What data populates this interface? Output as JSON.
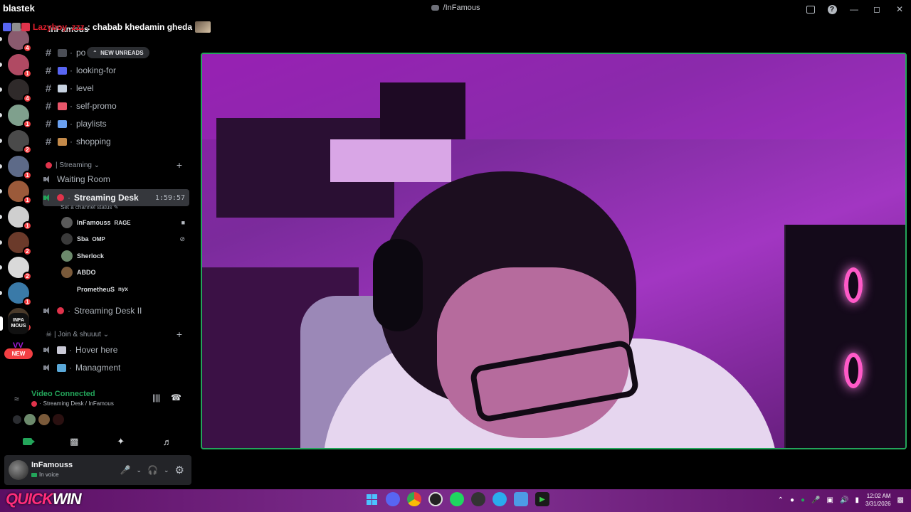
{
  "window": {
    "title": "/InFamous"
  },
  "overlay": {
    "streamer": "blastek",
    "chat_user": "Lazyboy_zzz",
    "chat_message": ": chabab khedamin gheda"
  },
  "rail": {
    "servers": [
      {
        "badge": "4",
        "color": "#8a5a6e"
      },
      {
        "badge": "1",
        "color": "#b04a63"
      },
      {
        "badge": "4",
        "color": "#2f2a2a"
      },
      {
        "badge": "1",
        "color": "#7fa08d"
      },
      {
        "badge": "2",
        "color": "#4a4a4a"
      },
      {
        "badge": "1",
        "color": "#5d6a88"
      },
      {
        "badge": "1",
        "color": "#9b5a3a"
      },
      {
        "badge": "1",
        "color": "#cfcfcf"
      },
      {
        "badge": "2",
        "color": "#6b3a2a"
      },
      {
        "badge": "2",
        "color": "#d9d9d9"
      },
      {
        "badge": "1",
        "color": "#3a7aa8"
      },
      {
        "badge": "2",
        "color": "#4a3a2a"
      }
    ],
    "infamous_label": "INFA MOUS",
    "new_label": "NEW"
  },
  "channels": {
    "server_name": "InFamous",
    "new_unreads": "NEW UNREADS",
    "partial_first": "po",
    "text_channels": [
      {
        "name": "looking-for",
        "emoji_color": "#5865f2"
      },
      {
        "name": "level",
        "emoji_color": "#c7d2e0"
      },
      {
        "name": "self-promo",
        "emoji_color": "#e8566a"
      },
      {
        "name": "playlists",
        "emoji_color": "#6aa0f0"
      },
      {
        "name": "shopping",
        "emoji_color": "#c48a4a"
      }
    ],
    "category_streaming": "| Streaming",
    "waiting_room": "Waiting Room",
    "active_channel": {
      "name": "Streaming Desk",
      "timer": "1:59:57",
      "status": "Set a channel status"
    },
    "members": [
      {
        "name": "InFamouss",
        "tag": "RAGE",
        "color": "#5a5a5a"
      },
      {
        "name": "Sba",
        "tag": "OMP",
        "color": "#3a3a3a"
      },
      {
        "name": "Sherlock",
        "tag": "",
        "color": "#6c8a6c"
      },
      {
        "name": "ABDO",
        "tag": "",
        "color": "#7a5a3a"
      },
      {
        "name": "PrometheuS",
        "tag": "nyx",
        "color": "#000000"
      }
    ],
    "streaming_desk_2": "Streaming Desk II",
    "category_join": "| Join & shuuut",
    "hover_here": "Hover here",
    "managment": "Managment"
  },
  "voice_panel": {
    "title": "Video Connected",
    "subtitle": "Streaming Desk / InFamous"
  },
  "user_panel": {
    "name": "InFamouss",
    "status": "In voice"
  },
  "taskbar": {
    "brand_a": "QUICK",
    "brand_b": "WIN",
    "time": "12:02 AM",
    "date": "3/31/2026"
  }
}
